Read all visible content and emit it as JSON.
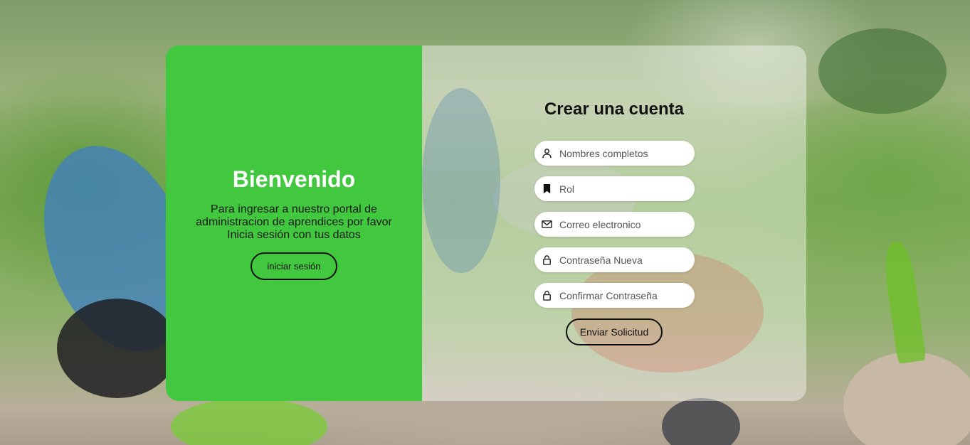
{
  "welcome": {
    "title": "Bienvenido",
    "message": "Para ingresar a nuestro portal de administracion de aprendices por favor Inicia sesión con tus datos",
    "login_label": "iniciar sesión"
  },
  "register": {
    "title": "Crear una cuenta",
    "fields": [
      {
        "placeholder": "Nombres completos",
        "icon": "user-icon"
      },
      {
        "placeholder": "Rol",
        "icon": "bookmark-icon"
      },
      {
        "placeholder": "Correo electronico",
        "icon": "envelope-icon"
      },
      {
        "placeholder": "Contraseña Nueva",
        "icon": "lock-icon"
      },
      {
        "placeholder": "Confirmar Contraseña",
        "icon": "lock-icon"
      }
    ],
    "submit_label": "Enviar Solicitud"
  },
  "colors": {
    "accent_green": "#41c83e",
    "button_border": "#111111"
  }
}
